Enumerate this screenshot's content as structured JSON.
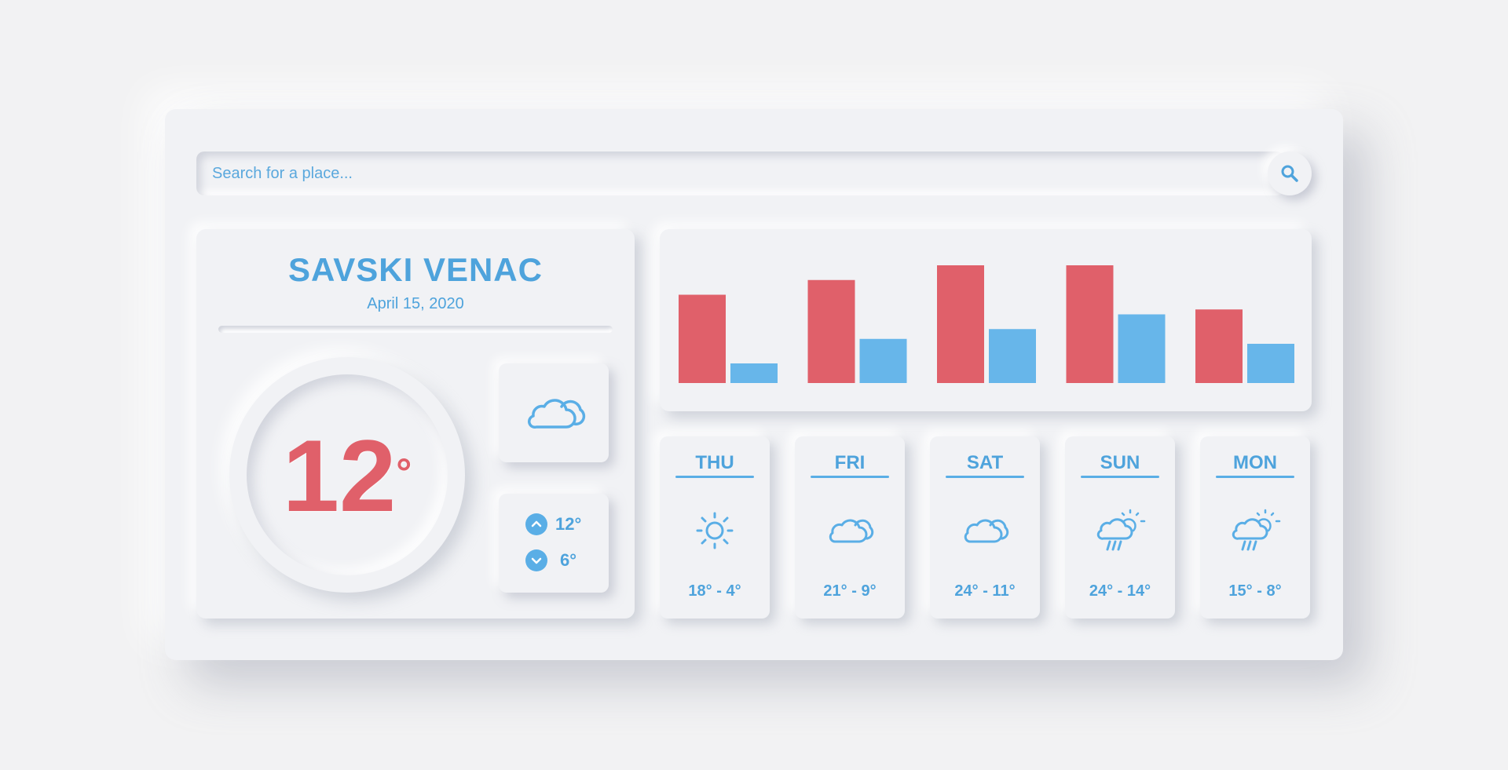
{
  "search": {
    "placeholder": "Search for a place..."
  },
  "current": {
    "city": "SAVSKI VENAC",
    "date": "April 15, 2020",
    "temperature": "12",
    "degree_symbol": "°",
    "condition_icon": "cloud-icon",
    "high": "12°",
    "low": "6°"
  },
  "forecast": [
    {
      "day": "THU",
      "icon": "sun-icon",
      "range": "18° - 4°"
    },
    {
      "day": "FRI",
      "icon": "cloud-icon",
      "range": "21° - 9°"
    },
    {
      "day": "SAT",
      "icon": "cloud-icon",
      "range": "24° - 11°"
    },
    {
      "day": "SUN",
      "icon": "rain-sun-icon",
      "range": "24° - 14°"
    },
    {
      "day": "MON",
      "icon": "rain-sun-icon",
      "range": "15° - 8°"
    }
  ],
  "colors": {
    "accent": "#4ea3dc",
    "high": "#e0606a",
    "low": "#67b6ea",
    "background": "#f1f2f5"
  },
  "chart_data": {
    "type": "bar",
    "categories": [
      "THU",
      "FRI",
      "SAT",
      "SUN",
      "MON"
    ],
    "series": [
      {
        "values": [
          18,
          21,
          24,
          24,
          15
        ]
      },
      {
        "values": [
          4,
          9,
          11,
          14,
          8
        ]
      }
    ],
    "ylim": [
      0,
      24
    ],
    "colors": [
      "#e0606a",
      "#67b6ea"
    ],
    "grid": false,
    "axes_visible": false
  }
}
